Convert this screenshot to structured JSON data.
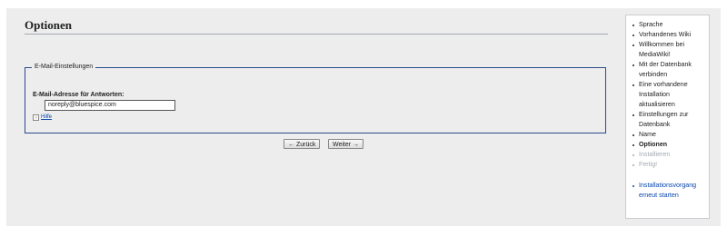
{
  "page": {
    "title": "Optionen"
  },
  "email_section": {
    "legend": "E-Mail-Einstellungen",
    "field_label": "E-Mail-Adresse für Antworten:",
    "field_value": "noreply@bluespice.com",
    "help_label": "Hilfe"
  },
  "buttons": {
    "back": "← Zurück",
    "next": "Weiter →"
  },
  "sidebar": {
    "steps": [
      {
        "label": "Sprache",
        "state": "done"
      },
      {
        "label": "Vorhandenes Wiki",
        "state": "done"
      },
      {
        "label": "Willkommen bei MediaWiki!",
        "state": "done"
      },
      {
        "label": "Mit der Datenbank verbinden",
        "state": "done"
      },
      {
        "label": "Eine vorhandene Installation aktualisieren",
        "state": "done"
      },
      {
        "label": "Einstellungen zur Datenbank",
        "state": "done"
      },
      {
        "label": "Name",
        "state": "done"
      },
      {
        "label": "Optionen",
        "state": "current"
      },
      {
        "label": "Installieren",
        "state": "pending"
      },
      {
        "label": "Fertig!",
        "state": "pending"
      }
    ],
    "restart_label": "Installationsvorgang erneut starten"
  }
}
